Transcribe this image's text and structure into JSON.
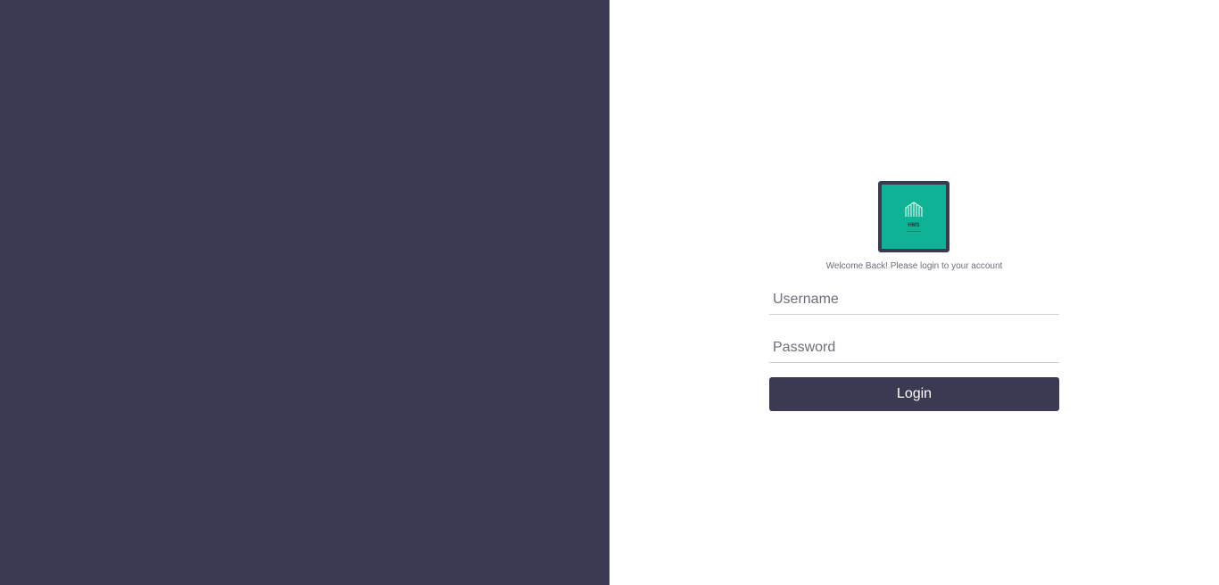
{
  "logo": {
    "brand_text": "HMS",
    "tagline_text": "",
    "icon": "building-logo-icon",
    "bg_color": "#0db394",
    "frame_color": "#3c3a52"
  },
  "welcome_text": "Welcome Back! Please login to your account",
  "form": {
    "username": {
      "value": "",
      "placeholder": "Username"
    },
    "password": {
      "value": "",
      "placeholder": "Password"
    },
    "login_label": "Login"
  },
  "colors": {
    "left_panel": "#3c3a52",
    "accent": "#3c3a52",
    "right_panel": "#ffffff"
  }
}
